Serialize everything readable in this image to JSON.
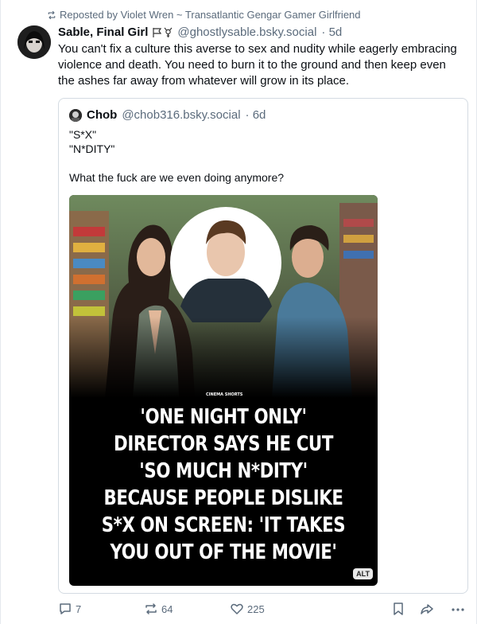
{
  "repost": {
    "icon": "repost-icon",
    "text": "Reposted by Violet Wren ~ Transatlantic Gengar Gamer Girlfriend"
  },
  "post": {
    "author": "Sable, Final Girl",
    "flags": "🏳⚧",
    "handle": "@ghostlysable.bsky.social",
    "time": "· 5d",
    "text": "You can't fix a culture this averse to sex and nudity while eagerly embracing violence and death. You need to burn it to the ground and then keep even the ashes far away from whatever will grow in its place."
  },
  "quote": {
    "author": "Chob",
    "handle": "@chob316.bsky.social",
    "time": "· 6d",
    "lines": [
      "\"S*X\"",
      "\"N*DITY\"",
      "",
      "What the fuck are we even doing anymore?"
    ],
    "image": {
      "logo": "CINEMA SHORTS",
      "headline": [
        "'ONE NIGHT ONLY'",
        "DIRECTOR SAYS HE CUT",
        "'SO MUCH N*DITY'",
        "BECAUSE PEOPLE DISLIKE",
        "S*X ON SCREEN: 'IT TAKES",
        "YOU OUT OF THE MOVIE'"
      ],
      "alt_badge": "ALT"
    }
  },
  "actions": {
    "reply_count": "7",
    "repost_count": "64",
    "like_count": "225"
  },
  "colors": {
    "muted": "#5b6b7c",
    "border": "#d4dbe2"
  }
}
